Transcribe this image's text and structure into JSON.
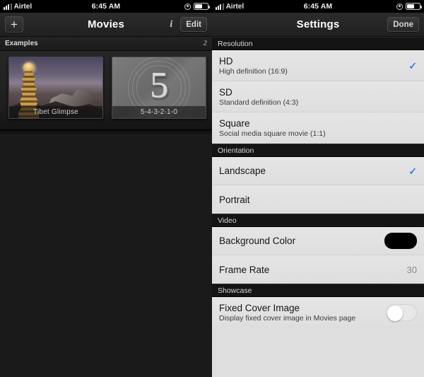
{
  "status_bar": {
    "carrier": "Airtel",
    "time": "6:45 AM",
    "signal_bars_filled": 3,
    "signal_bars_total": 4,
    "rotation_lock_icon": "rotation-lock-icon",
    "battery_icon": "battery-icon",
    "battery_level_percent": 58
  },
  "left_panel": {
    "navbar": {
      "add_label": "+",
      "title": "Movies",
      "info_label": "i",
      "edit_label": "Edit"
    },
    "section": {
      "title": "Examples",
      "count": "2"
    },
    "items": [
      {
        "caption": "Tibet Glimpse",
        "art": "tibet-photo"
      },
      {
        "caption": "5-4-3-2-1-0",
        "art": "countdown-leader",
        "number": "5"
      }
    ]
  },
  "right_panel": {
    "navbar": {
      "title": "Settings",
      "done_label": "Done"
    },
    "accent_color": "#2f7cf6",
    "sections": [
      {
        "header": "Resolution",
        "rows": [
          {
            "title": "HD",
            "subtitle": "High definition (16:9)",
            "control": "check",
            "selected": true
          },
          {
            "title": "SD",
            "subtitle": "Standard definition (4:3)",
            "control": "none",
            "selected": false
          },
          {
            "title": "Square",
            "subtitle": "Social media square movie (1:1)",
            "control": "none",
            "selected": false
          }
        ]
      },
      {
        "header": "Orientation",
        "rows": [
          {
            "title": "Landscape",
            "subtitle": "",
            "control": "check",
            "selected": true
          },
          {
            "title": "Portrait",
            "subtitle": "",
            "control": "none",
            "selected": false
          }
        ]
      },
      {
        "header": "Video",
        "rows": [
          {
            "title": "Background Color",
            "subtitle": "",
            "control": "swatch",
            "swatch_color": "#000000"
          },
          {
            "title": "Frame Rate",
            "subtitle": "",
            "control": "value",
            "value": "30"
          }
        ]
      },
      {
        "header": "Showcase",
        "rows": [
          {
            "title": "Fixed Cover Image",
            "subtitle": "Display fixed cover image in Movies page",
            "control": "toggle",
            "toggle_on": false
          }
        ]
      }
    ]
  }
}
